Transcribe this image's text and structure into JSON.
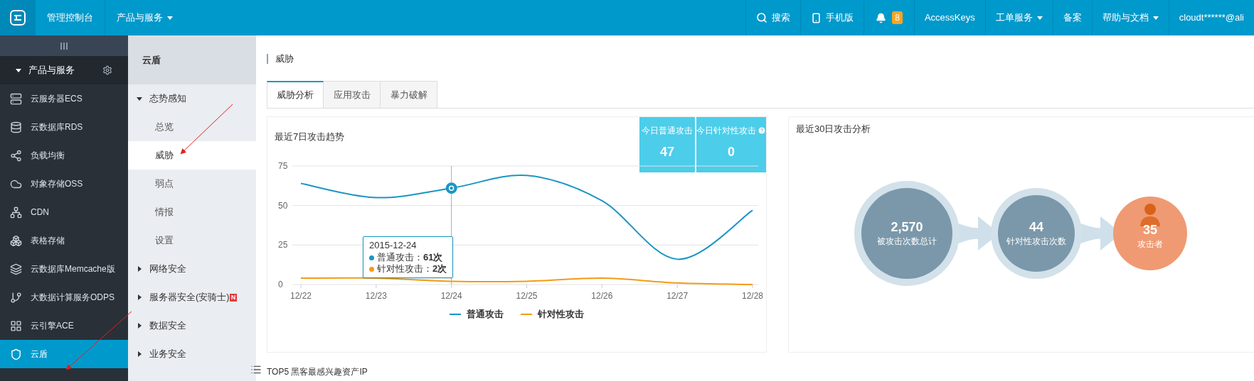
{
  "topbar": {
    "title": "管理控制台",
    "left_menu": {
      "label": "产品与服务",
      "kind": "dropdown"
    },
    "items": [
      {
        "label": "搜索",
        "kind": "search"
      },
      {
        "label": "手机版",
        "kind": "mobile"
      },
      {
        "label": "8",
        "kind": "bell"
      },
      {
        "label": "AccessKeys",
        "kind": "link"
      },
      {
        "label": "工单服务",
        "kind": "dropdown"
      },
      {
        "label": "备案",
        "kind": "link"
      },
      {
        "label": "帮助与文档",
        "kind": "dropdown"
      },
      {
        "label": "cloudt******@ali",
        "kind": "link"
      }
    ]
  },
  "sidebar": {
    "header": "产品与服务",
    "expanded": true,
    "items": [
      {
        "label": "云服务器ECS",
        "selected": false
      },
      {
        "label": "云数据库RDS",
        "selected": false
      },
      {
        "label": "负载均衡",
        "selected": false
      },
      {
        "label": "对象存储OSS",
        "selected": false
      },
      {
        "label": "CDN",
        "selected": false
      },
      {
        "label": "表格存储",
        "selected": false
      },
      {
        "label": "云数据库Memcache版",
        "selected": false
      },
      {
        "label": "大数据计算服务ODPS",
        "selected": false
      },
      {
        "label": "云引擎ACE",
        "selected": false
      },
      {
        "label": "云盾",
        "selected": true
      }
    ]
  },
  "subnav": {
    "title": "云盾",
    "groups": [
      {
        "label": "态势感知",
        "expanded": true,
        "children": [
          {
            "label": "总览",
            "selected": false
          },
          {
            "label": "威胁",
            "selected": true
          },
          {
            "label": "弱点",
            "selected": false
          },
          {
            "label": "情报",
            "selected": false
          },
          {
            "label": "设置",
            "selected": false
          }
        ]
      },
      {
        "label": "网络安全",
        "expanded": false
      },
      {
        "label": "服务器安全(安骑士)",
        "expanded": false,
        "badge": "N"
      },
      {
        "label": "数据安全",
        "expanded": false
      },
      {
        "label": "业务安全",
        "expanded": false
      }
    ]
  },
  "page_title": "威胁",
  "tabs": [
    {
      "label": "威胁分析",
      "selected": true
    },
    {
      "label": "应用攻击",
      "selected": false
    },
    {
      "label": "暴力破解",
      "selected": false
    }
  ],
  "trend_card": {
    "title": "最近7日攻击趋势",
    "stats": [
      {
        "label": "今日普通攻击",
        "value": "47",
        "help": false
      },
      {
        "label": "今日针对性攻击",
        "value": "0",
        "help": true
      }
    ],
    "chart_data": {
      "type": "line",
      "categories": [
        "12/22",
        "12/23",
        "12/24",
        "12/25",
        "12/26",
        "12/27",
        "12/28"
      ],
      "ylim": [
        0,
        75
      ],
      "yticks": [
        {
          "value": 0,
          "label": "0"
        },
        {
          "value": 25,
          "label": "25"
        },
        {
          "value": 50,
          "label": "50"
        },
        {
          "value": 75,
          "label": "75"
        }
      ],
      "legend": "bottom",
      "series": [
        {
          "name": "普通攻击",
          "color": "#1a96c4",
          "values": [
            64,
            55,
            61,
            69,
            53,
            16,
            47
          ]
        },
        {
          "name": "针对性攻击",
          "color": "#f39c12",
          "values": [
            4,
            4,
            2,
            2,
            4,
            1,
            0
          ]
        }
      ],
      "ref_lines": [
        {
          "axis": "x",
          "value": "12/24"
        }
      ]
    },
    "tooltip": {
      "date": "2015-12-24",
      "rows": [
        "普通攻击：**61次**",
        "针对性攻击：**2次**"
      ]
    }
  },
  "analysis_card": {
    "title": "最近30日攻击分析",
    "steps": [
      {
        "value": "2,570",
        "label": "被攻击次数总计",
        "kind": "large"
      },
      {
        "value": "44",
        "label": "针对性攻击次数",
        "kind": "medium"
      },
      {
        "value": "35",
        "label": "攻击者",
        "kind": "attacker"
      }
    ]
  },
  "section_title": "TOP5 黑客最感兴趣资产IP"
}
